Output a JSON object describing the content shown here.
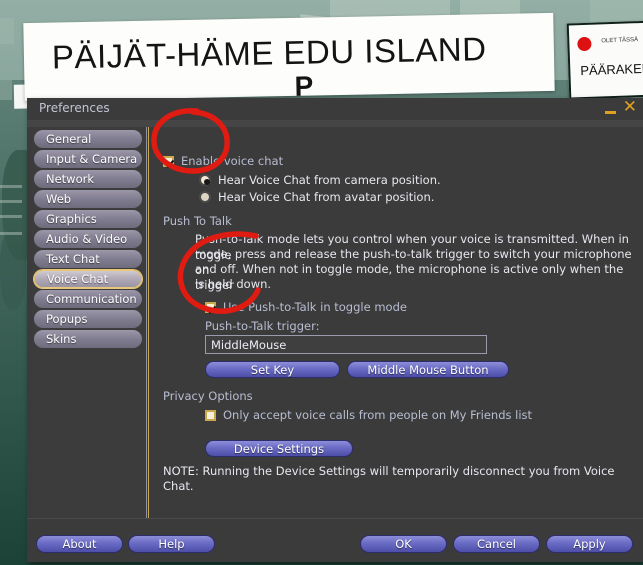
{
  "background": {
    "main_sign_text": "PÄIJÄT-HÄME EDU ISLAND",
    "main_sign_sub": "P",
    "right_sign_small": "OLET TÄSSÄ",
    "right_sign_big": "PÄÄRAKEN"
  },
  "window": {
    "title": "Preferences",
    "minimize_icon": "minimize-icon",
    "close_icon": "close-icon"
  },
  "sidebar": {
    "items": [
      {
        "label": "General",
        "active": false
      },
      {
        "label": "Input & Camera",
        "active": false
      },
      {
        "label": "Network",
        "active": false
      },
      {
        "label": "Web",
        "active": false
      },
      {
        "label": "Graphics",
        "active": false
      },
      {
        "label": "Audio & Video",
        "active": false
      },
      {
        "label": "Text Chat",
        "active": false
      },
      {
        "label": "Voice Chat",
        "active": true
      },
      {
        "label": "Communication",
        "active": false
      },
      {
        "label": "Popups",
        "active": false
      },
      {
        "label": "Skins",
        "active": false
      }
    ]
  },
  "content": {
    "enable_voice_chat": {
      "label": "Enable voice chat",
      "checked": true
    },
    "hear_from_camera": {
      "label": "Hear Voice Chat from camera position.",
      "selected": true
    },
    "hear_from_avatar": {
      "label": "Hear Voice Chat from avatar position.",
      "selected": false
    },
    "push_to_talk": {
      "heading": "Push To Talk",
      "description_line1": "Push-to-Talk mode lets you control when your voice is transmitted. When in toggle",
      "description_line2": "mode, press and release the push-to-talk trigger to switch your microphone on",
      "description_line3": "and off. When not in toggle mode, the microphone is active only when the trigger",
      "description_line4": "is held down.",
      "toggle_mode": {
        "label": "Use Push-to-Talk in toggle mode",
        "checked": true
      },
      "trigger_label": "Push-to-Talk trigger:",
      "trigger_value": "MiddleMouse",
      "set_key_button": "Set Key",
      "middle_mouse_button": "Middle Mouse Button"
    },
    "privacy_options": {
      "heading": "Privacy Options",
      "friends_only": {
        "label": "Only accept voice calls from people on My Friends list",
        "checked": false
      }
    },
    "device_settings_button": "Device Settings",
    "note_line1": "NOTE: Running the Device Settings will temporarily disconnect you from Voice",
    "note_line2": "Chat."
  },
  "footer": {
    "about": "About",
    "help": "Help",
    "ok": "OK",
    "cancel": "Cancel",
    "apply": "Apply"
  },
  "colors": {
    "panel_bg": "#3b3b3b",
    "accent_gold": "#c9a84c",
    "button_blue": "#6a6bc4",
    "annotation_red": "#e01b12",
    "label_text": "#b9bdd2"
  }
}
